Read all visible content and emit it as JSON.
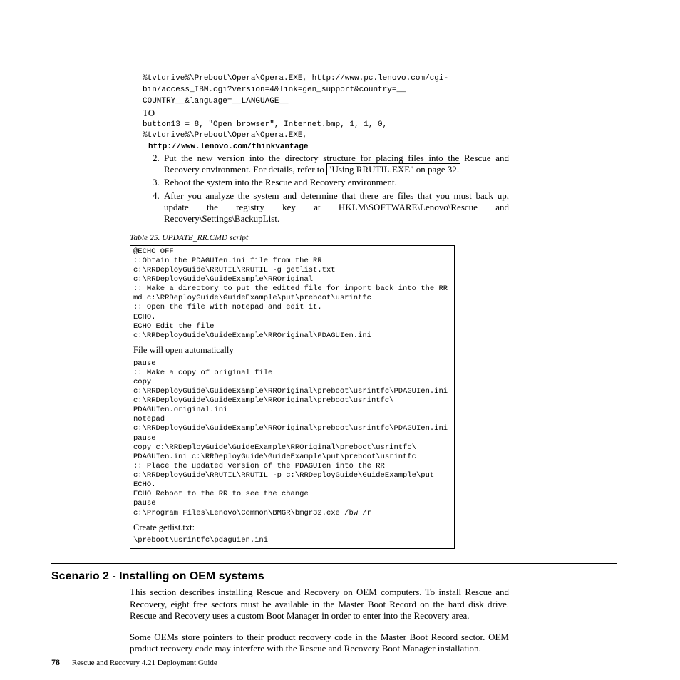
{
  "code1": {
    "l1": "%tvtdrive%\\Preboot\\Opera\\Opera.EXE, http://www.pc.lenovo.com/cgi-",
    "l2": "bin/access_IBM.cgi?version=4&link=gen_support&country=__",
    "l3": "COUNTRY__&language=__LANGUAGE__"
  },
  "to": "TO",
  "code2": {
    "l1": "button13 = 8, \"Open browser\", Internet.bmp, 1, 1, 0,",
    "l2": "%tvtdrive%\\Preboot\\Opera\\Opera.EXE,"
  },
  "bold_url": "http://www.lenovo.com/thinkvantage",
  "list": {
    "n2": "2.",
    "i2a": "Put the new version into the directory structure for placing files into the Rescue and Recovery environment. For details, refer to ",
    "i2link": "\"Using RRUTIL.EXE\" on page 32.",
    "n3": "3.",
    "i3": "Reboot the system into the Rescue and Recovery environment.",
    "n4": "4.",
    "i4": "After you analyze the system and determine that there are files that you must back up, update the registry key at HKLM\\SOFTWARE\\Lenovo\\Rescue and Recovery\\Settings\\BackupList."
  },
  "table_caption": "Table 25. UPDATE_RR.CMD script",
  "script": {
    "b1": "@ECHO OFF\n::Obtain the PDAGUIen.ini file from the RR\nc:\\RRDeployGuide\\RRUTIL\\RRUTIL -g getlist.txt\nc:\\RRDeployGuide\\GuideExample\\RROriginal\n:: Make a directory to put the edited file for import back into the RR\nmd c:\\RRDeployGuide\\GuideExample\\put\\preboot\\usrintfc\n:: Open the file with notepad and edit it.\nECHO.\nECHO Edit the file\nc:\\RRDeployGuide\\GuideExample\\RROriginal\\PDAGUIen.ini",
    "s1": "File will open automatically",
    "b2": "pause\n:: Make a copy of original file\ncopy\nc:\\RRDeployGuide\\GuideExample\\RROriginal\\preboot\\usrintfc\\PDAGUIen.ini\nc:\\RRDeployGuide\\GuideExample\\RROriginal\\preboot\\usrintfc\\\nPDAGUIen.original.ini\nnotepad\nc:\\RRDeployGuide\\GuideExample\\RROriginal\\preboot\\usrintfc\\PDAGUIen.ini\npause\ncopy c:\\RRDeployGuide\\GuideExample\\RROriginal\\preboot\\usrintfc\\\nPDAGUIen.ini c:\\RRDeployGuide\\GuideExample\\put\\preboot\\usrintfc\n:: Place the updated version of the PDAGUIen into the RR\nc:\\RRDeployGuide\\RRUTIL\\RRUTIL -p c:\\RRDeployGuide\\GuideExample\\put\nECHO.\nECHO Reboot to the RR to see the change\npause\nc:\\Program Files\\Lenovo\\Common\\BMGR\\bmgr32.exe /bw /r",
    "s2": "Create getlist.txt:",
    "b3": "\\preboot\\usrintfc\\pdaguien.ini"
  },
  "scenario_heading": "Scenario 2 - Installing on OEM systems",
  "para1": "This section describes installing Rescue and Recovery on OEM computers. To install Rescue and Recovery, eight free sectors must be available in the Master Boot Record on the hard disk drive. Rescue and Recovery uses a custom Boot Manager in order to enter into the Recovery area.",
  "para2": "Some OEMs store pointers to their product recovery code in the Master Boot Record sector. OEM product recovery code may interfere with the Rescue and Recovery Boot Manager installation.",
  "footer": {
    "page": "78",
    "title": "Rescue and Recovery 4.21 Deployment Guide"
  }
}
